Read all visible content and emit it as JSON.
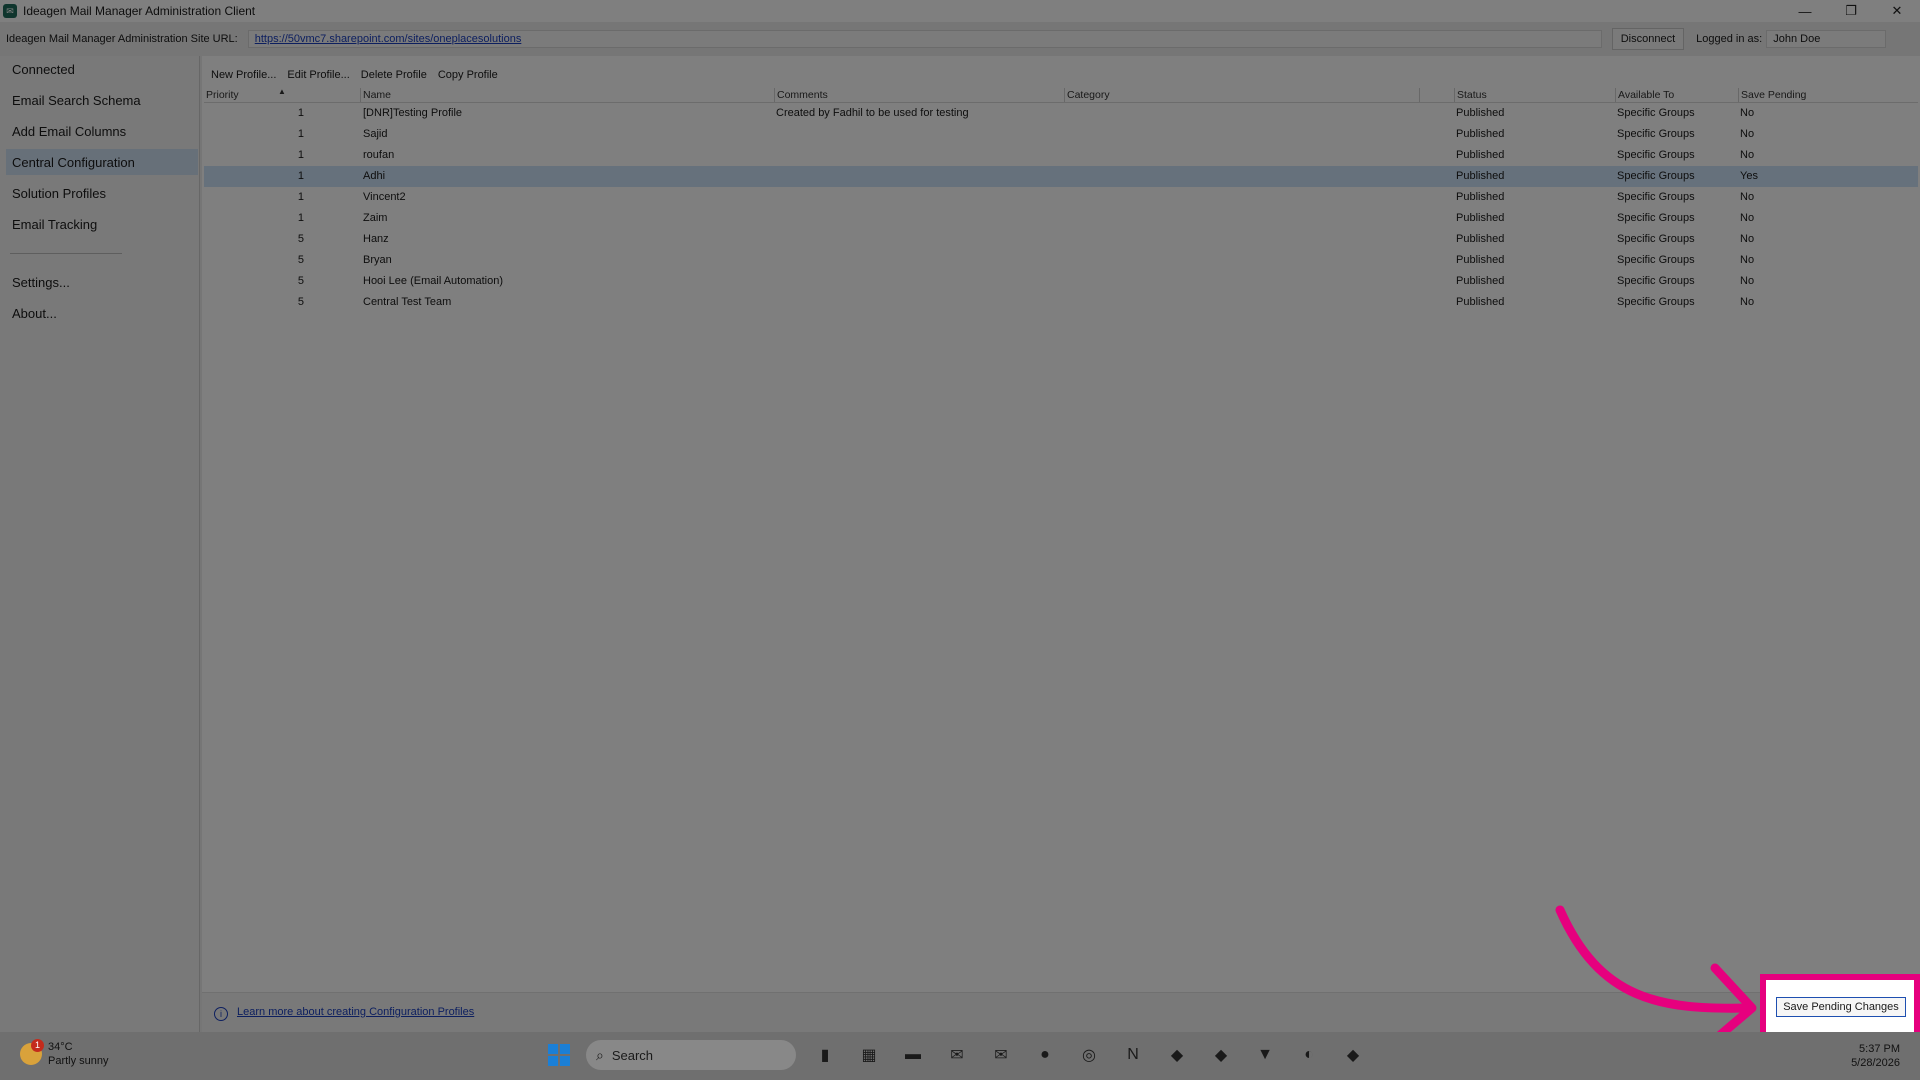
{
  "window": {
    "title": "Ideagen Mail Manager Administration Client",
    "minimize": "—",
    "restore": "❐",
    "close": "✕"
  },
  "urlbar": {
    "label": "Ideagen Mail Manager Administration Site URL:",
    "url": "https://50vmc7.sharepoint.com/sites/oneplacesolutions",
    "disconnect": "Disconnect",
    "logged_label": "Logged in as:",
    "logged_user": "John  Doe"
  },
  "sidebar": {
    "items": [
      {
        "label": "Connected"
      },
      {
        "label": "Email Search Schema"
      },
      {
        "label": "Add Email Columns"
      },
      {
        "label": "Central Configuration"
      },
      {
        "label": "Solution Profiles"
      },
      {
        "label": "Email Tracking"
      },
      {
        "label": "Settings..."
      },
      {
        "label": "About..."
      }
    ]
  },
  "toolbar": {
    "new_profile": "New Profile...",
    "edit_profile": "Edit Profile...",
    "delete_profile": "Delete Profile",
    "copy_profile": "Copy Profile"
  },
  "grid": {
    "columns": [
      "Priority",
      "Name",
      "Comments",
      "Category",
      "Status",
      "Available To",
      "Save Pending"
    ],
    "sort_arrow": "▲",
    "rows": [
      {
        "priority": "1",
        "name": "[DNR]Testing Profile",
        "comments": "Created by Fadhil to be used for testing",
        "category": "",
        "status": "Published",
        "available": "Specific Groups",
        "pending": "No"
      },
      {
        "priority": "1",
        "name": "Sajid",
        "comments": "",
        "category": "",
        "status": "Published",
        "available": "Specific Groups",
        "pending": "No"
      },
      {
        "priority": "1",
        "name": "roufan",
        "comments": "",
        "category": "",
        "status": "Published",
        "available": "Specific Groups",
        "pending": "No"
      },
      {
        "priority": "1",
        "name": "Adhi",
        "comments": "",
        "category": "",
        "status": "Published",
        "available": "Specific Groups",
        "pending": "Yes"
      },
      {
        "priority": "1",
        "name": "Vincent2",
        "comments": "",
        "category": "",
        "status": "Published",
        "available": "Specific Groups",
        "pending": "No"
      },
      {
        "priority": "1",
        "name": "Zaim",
        "comments": "",
        "category": "",
        "status": "Published",
        "available": "Specific Groups",
        "pending": "No"
      },
      {
        "priority": "5",
        "name": "Hanz",
        "comments": "",
        "category": "",
        "status": "Published",
        "available": "Specific Groups",
        "pending": "No"
      },
      {
        "priority": "5",
        "name": "Bryan",
        "comments": "",
        "category": "",
        "status": "Published",
        "available": "Specific Groups",
        "pending": "No"
      },
      {
        "priority": "5",
        "name": "Hooi Lee (Email Automation)",
        "comments": "",
        "category": "",
        "status": "Published",
        "available": "Specific Groups",
        "pending": "No"
      },
      {
        "priority": "5",
        "name": "Central Test Team",
        "comments": "",
        "category": "",
        "status": "Published",
        "available": "Specific Groups",
        "pending": "No"
      }
    ]
  },
  "footer": {
    "info_icon": "i",
    "learn_link": "Learn more about creating Configuration Profiles",
    "save_button": "Save Pending Changes"
  },
  "highlight": {
    "color": "#e6007e"
  },
  "taskbar": {
    "weather_temp": "34°C",
    "weather_desc": "Partly sunny",
    "weather_badge": "1",
    "search_placeholder": "Search",
    "search_icon": "⌕",
    "time": "5:37 PM",
    "date": "5/28/2026",
    "apps": [
      {
        "name": "task-view-icon",
        "glyph": "▮"
      },
      {
        "name": "store-icon",
        "glyph": "▦"
      },
      {
        "name": "file-explorer-icon",
        "glyph": "▬"
      },
      {
        "name": "outlook-icon",
        "glyph": "✉"
      },
      {
        "name": "outlook-classic-icon",
        "glyph": "✉"
      },
      {
        "name": "teams-icon",
        "glyph": "●"
      },
      {
        "name": "chatgpt-icon",
        "glyph": "◎"
      },
      {
        "name": "onenote-icon",
        "glyph": "N"
      },
      {
        "name": "mail-manager-icon-1",
        "glyph": "◆"
      },
      {
        "name": "mail-manager-icon-2",
        "glyph": "◆"
      },
      {
        "name": "capture-icon",
        "glyph": "▼"
      },
      {
        "name": "edge-icon",
        "glyph": "◐"
      },
      {
        "name": "mail-manager-admin-icon",
        "glyph": "◆"
      }
    ]
  }
}
